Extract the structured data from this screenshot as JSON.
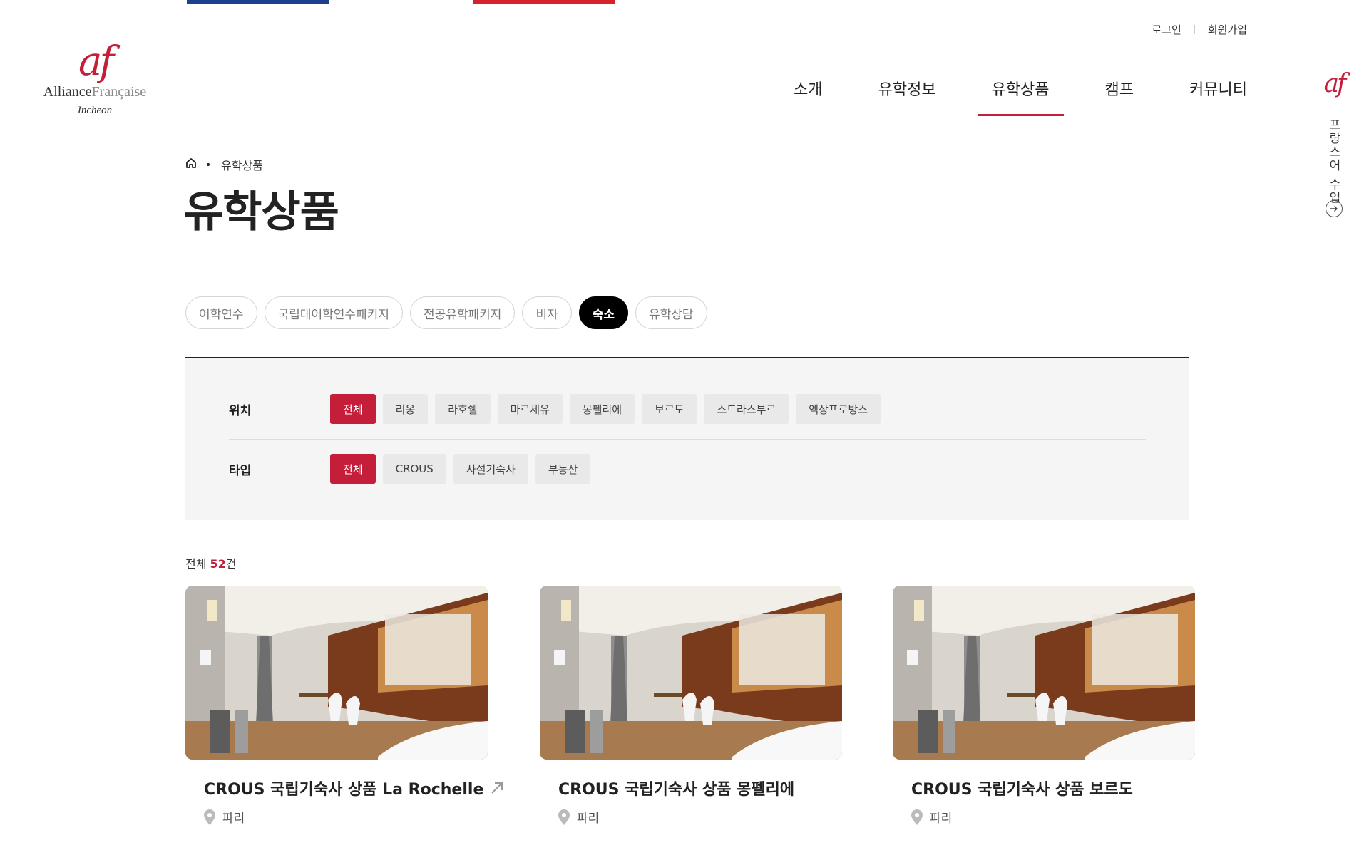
{
  "logo": {
    "mark": "af",
    "name_part1": "Alliance",
    "name_part2": "Française",
    "city": "Incheon"
  },
  "top_links": {
    "login": "로그인",
    "signup": "회원가입"
  },
  "nav": [
    {
      "label": "소개",
      "active": false
    },
    {
      "label": "유학정보",
      "active": false
    },
    {
      "label": "유학상품",
      "active": true
    },
    {
      "label": "캠프",
      "active": false
    },
    {
      "label": "커뮤니티",
      "active": false
    }
  ],
  "side_rail": {
    "mark": "af",
    "text": "프랑스어 수업",
    "icon": "arrow-right-circle-icon"
  },
  "breadcrumb": {
    "home_icon": "home-icon",
    "current": "유학상품"
  },
  "page_title": "유학상품",
  "categories": [
    {
      "label": "어학연수",
      "active": false
    },
    {
      "label": "국립대어학연수패키지",
      "active": false
    },
    {
      "label": "전공유학패키지",
      "active": false
    },
    {
      "label": "비자",
      "active": false
    },
    {
      "label": "숙소",
      "active": true
    },
    {
      "label": "유학상담",
      "active": false
    }
  ],
  "filters": {
    "location": {
      "label": "위치",
      "options": [
        "전체",
        "리옹",
        "라호쉘",
        "마르세유",
        "몽펠리에",
        "보르도",
        "스트라스부르",
        "엑상프로방스"
      ],
      "selected": "전체"
    },
    "type": {
      "label": "타입",
      "options": [
        "전체",
        "CROUS",
        "사설기숙사",
        "부동산"
      ],
      "selected": "전체"
    }
  },
  "count": {
    "prefix": "전체 ",
    "number": "52",
    "suffix": "건"
  },
  "cards": [
    {
      "title": "CROUS 국립기숙사 상품 La Rochelle",
      "location": "파리",
      "has_link_icon": true
    },
    {
      "title": "CROUS 국립기숙사 상품 몽펠리에",
      "location": "파리",
      "has_link_icon": false
    },
    {
      "title": "CROUS 국립기숙사 상품 보르도",
      "location": "파리",
      "has_link_icon": false
    }
  ],
  "colors": {
    "accent": "#c41e3a",
    "blue": "#1d3f8f",
    "panel": "#f5f5f5"
  }
}
